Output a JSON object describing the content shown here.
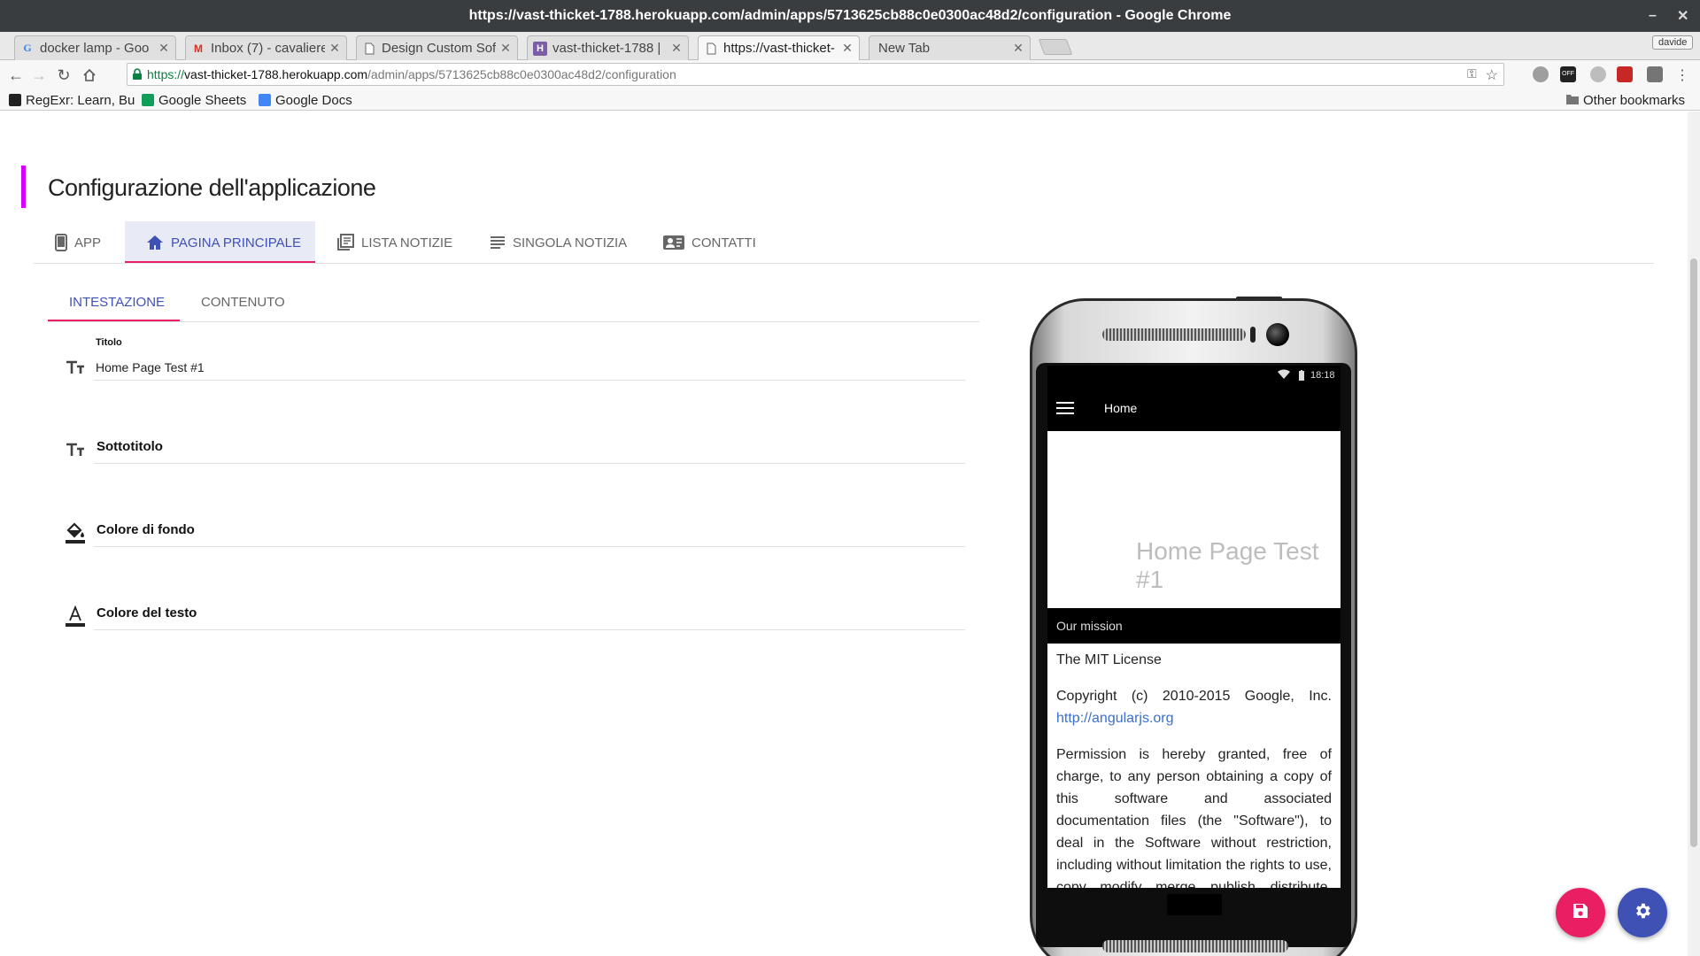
{
  "window": {
    "title": "https://vast-thicket-1788.herokuapp.com/admin/apps/5713625cb88c0e0300ac48d2/configuration - Google Chrome"
  },
  "tabs": [
    {
      "label": "docker lamp - Goo",
      "icon": "google-icon"
    },
    {
      "label": "Inbox (7) - cavaliere",
      "icon": "gmail-icon"
    },
    {
      "label": "Design Custom Soft",
      "icon": "page-icon"
    },
    {
      "label": "vast-thicket-1788 |",
      "icon": "heroku-icon"
    },
    {
      "label": "https://vast-thicket-",
      "icon": "page-icon",
      "active": true
    },
    {
      "label": "New Tab",
      "icon": ""
    }
  ],
  "profile": {
    "name": "davide"
  },
  "address_bar": {
    "scheme": "https://",
    "host": "vast-thicket-1788.herokuapp.com",
    "path": "/admin/apps/5713625cb88c0e0300ac48d2/configuration"
  },
  "bookmarks": {
    "items": [
      {
        "label": "RegExr: Learn, Bu",
        "icon": "regexr-icon"
      },
      {
        "label": "Google Sheets",
        "icon": "sheets-icon"
      },
      {
        "label": "Google Docs",
        "icon": "docs-icon"
      }
    ],
    "other": "Other bookmarks"
  },
  "page": {
    "title": "Configurazione dell'applicazione",
    "main_tabs": [
      {
        "label": "APP",
        "icon": "phone-icon"
      },
      {
        "label": "PAGINA PRINCIPALE",
        "icon": "home-icon",
        "active": true
      },
      {
        "label": "LISTA NOTIZIE",
        "icon": "library-books-icon"
      },
      {
        "label": "SINGOLA NOTIZIA",
        "icon": "subject-icon"
      },
      {
        "label": "CONTATTI",
        "icon": "contact-card-icon"
      }
    ],
    "sub_tabs": [
      {
        "label": "INTESTAZIONE",
        "active": true
      },
      {
        "label": "CONTENUTO"
      }
    ],
    "fields": {
      "titolo": {
        "label": "Titolo",
        "value": "Home Page Test #1",
        "icon": "text-size-icon"
      },
      "sottotitolo": {
        "label": "Sottotitolo",
        "icon": "text-size-icon"
      },
      "colore_fondo": {
        "label": "Colore di fondo",
        "icon": "fill-color-icon"
      },
      "colore_testo": {
        "label": "Colore del testo",
        "icon": "text-color-icon"
      }
    }
  },
  "phone_preview": {
    "time": "18:18",
    "appbar_title": "Home",
    "hero_title": "Home Page Test #1",
    "section_title": "Our mission",
    "p1": "The MIT License",
    "p2_text": "Copyright (c) 2010-2015 Google, Inc.",
    "p2_link": "http://angularjs.org",
    "p3": "Permission is hereby granted, free of charge, to any person obtaining a copy of this software and associated documentation files (the \"Software\"), to deal in the Software without restriction, including without limitation the rights to use, copy, modify, merge, publish, distribute, sublicense, and/or sell copies of the Software"
  },
  "fabs": [
    {
      "icon": "save-icon",
      "color": "#e91e63"
    },
    {
      "icon": "settings-icon",
      "color": "#3f51b5"
    }
  ],
  "colors": {
    "accent": "#d500f9",
    "primary": "#3f51b5",
    "ink": "#e91e63"
  }
}
